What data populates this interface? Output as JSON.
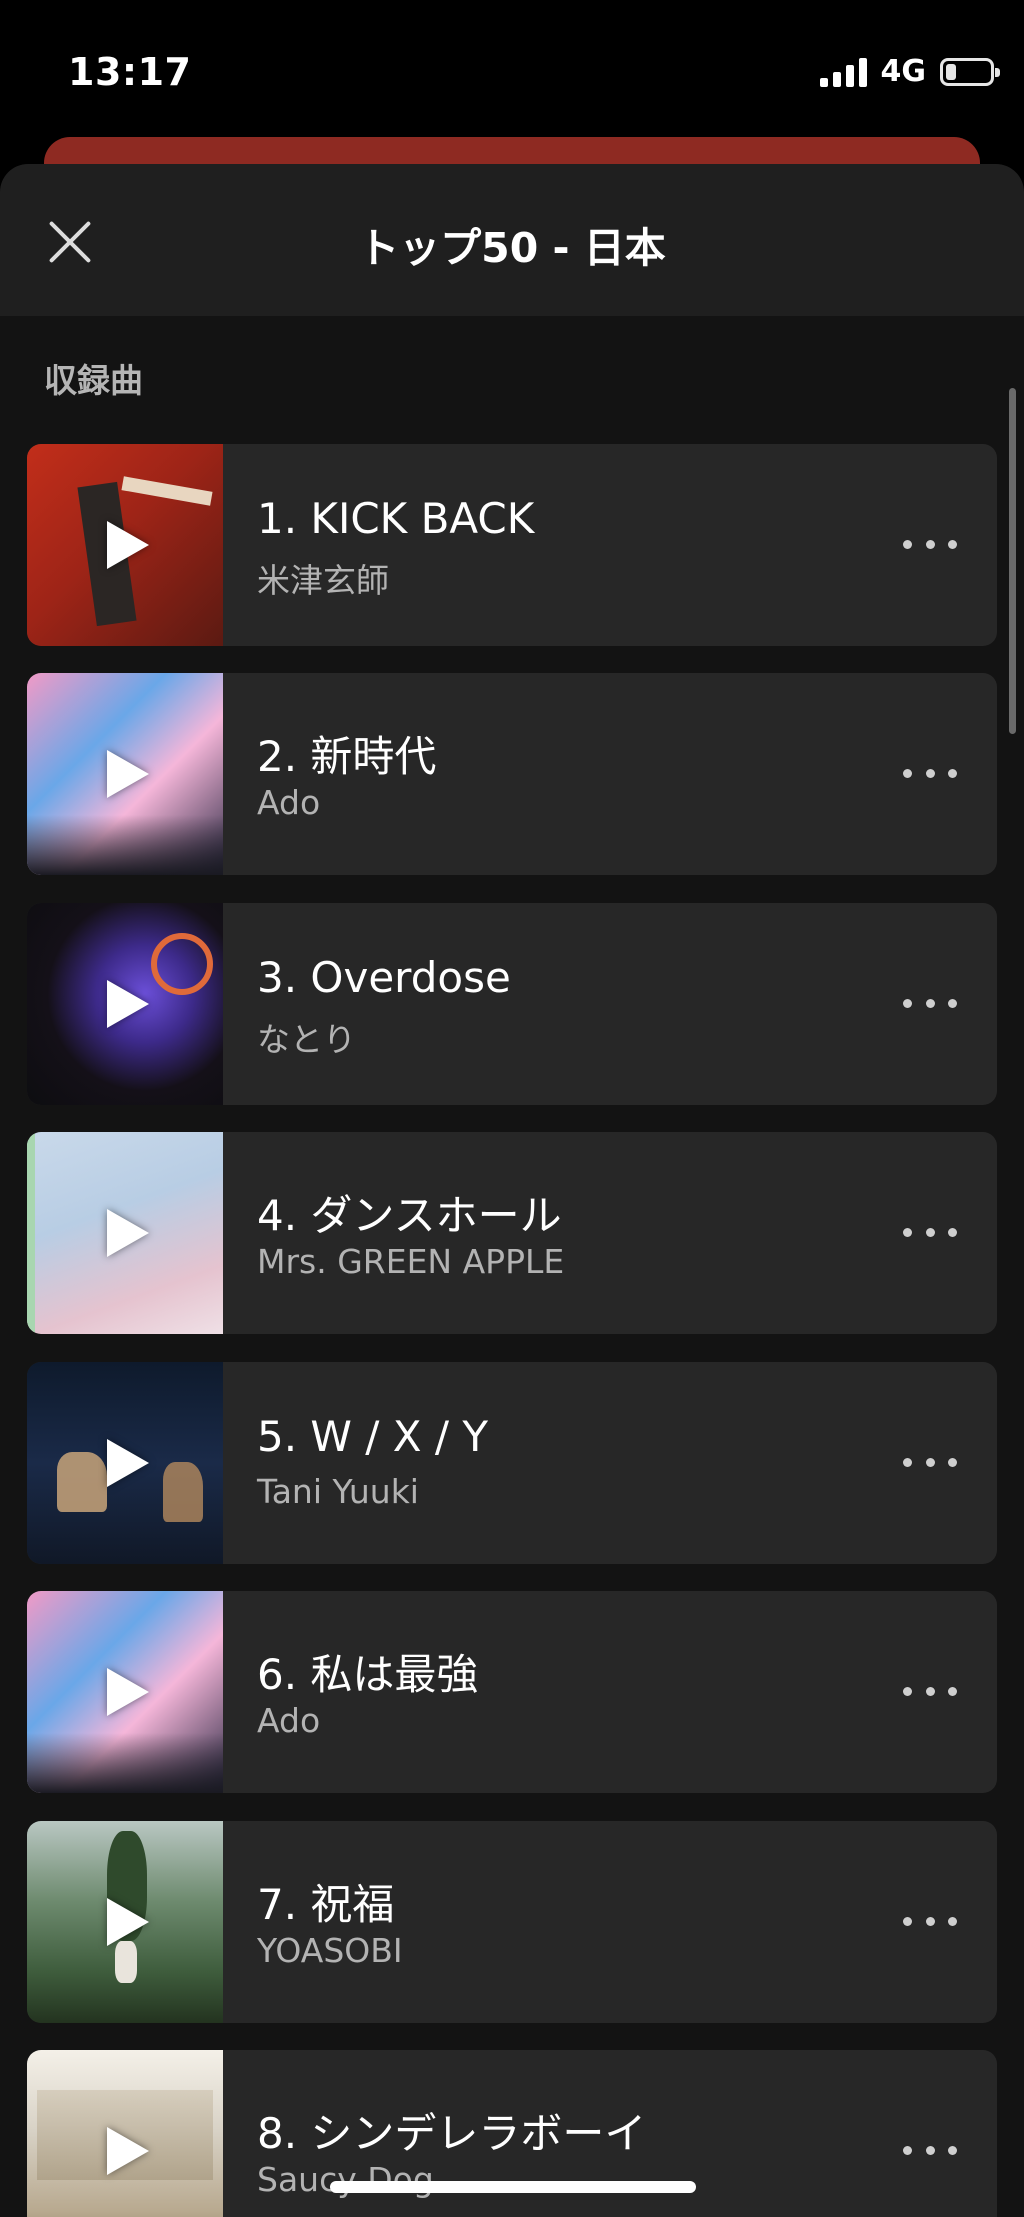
{
  "status_bar": {
    "time": "13:17",
    "network": "4G",
    "battery_level": 0.2,
    "signal_bars": 4
  },
  "sheet": {
    "title": "トップ50 - 日本",
    "close_icon": "close-x-icon",
    "section_label": "収録曲"
  },
  "tracks": [
    {
      "title": "1. KICK BACK",
      "artist": "米津玄師"
    },
    {
      "title": "2. 新時代",
      "artist": "Ado"
    },
    {
      "title": "3. Overdose",
      "artist": "なとり"
    },
    {
      "title": "4. ダンスホール",
      "artist": "Mrs. GREEN APPLE"
    },
    {
      "title": "5. W / X / Y",
      "artist": "Tani Yuuki"
    },
    {
      "title": "6. 私は最強",
      "artist": "Ado"
    },
    {
      "title": "7. 祝福",
      "artist": "YOASOBI"
    },
    {
      "title": "8. シンデレラボーイ",
      "artist": "Saucy Dog"
    }
  ],
  "colors": {
    "background": "#000000",
    "sheet": "#131313",
    "row": "#272727",
    "banner_behind": "#8e2a22"
  }
}
